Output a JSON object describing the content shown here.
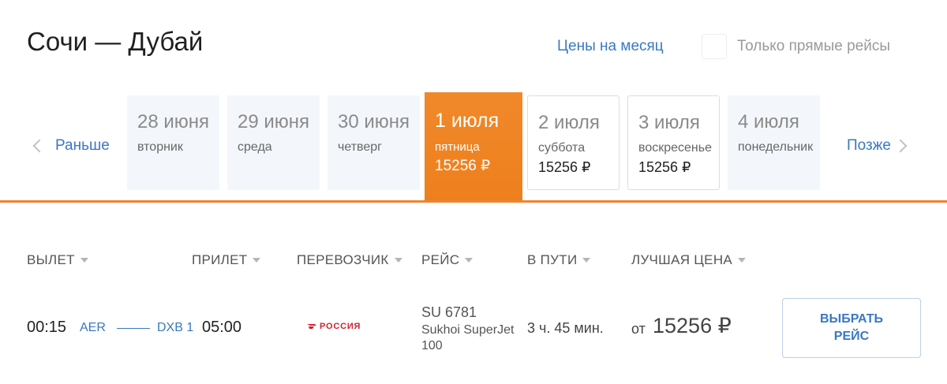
{
  "header": {
    "title": "Сочи — Дубай",
    "month_prices_link": "Цены на месяц",
    "direct_only_label": "Только прямые рейсы"
  },
  "date_nav": {
    "prev_label": "Раньше",
    "next_label": "Позже",
    "days": [
      {
        "date": "28 июня",
        "weekday": "вторник",
        "price": ""
      },
      {
        "date": "29 июня",
        "weekday": "среда",
        "price": ""
      },
      {
        "date": "30 июня",
        "weekday": "четверг",
        "price": ""
      },
      {
        "date": "1 июля",
        "weekday": "пятница",
        "price": "15256 ₽"
      },
      {
        "date": "2 июля",
        "weekday": "суббота",
        "price": "15256 ₽"
      },
      {
        "date": "3 июля",
        "weekday": "воскресенье",
        "price": "15256 ₽"
      },
      {
        "date": "4 июля",
        "weekday": "понедельник",
        "price": ""
      }
    ],
    "selected_index": 3
  },
  "table": {
    "columns": [
      "ВЫЛЕТ",
      "ПРИЛЕТ",
      "ПЕРЕВОЗЧИК",
      "РЕЙС",
      "В ПУТИ",
      "ЛУЧШАЯ ЦЕНА"
    ],
    "rows": [
      {
        "departure_time": "00:15",
        "departure_airport": "AER",
        "arrival_airport": "DXB 1",
        "arrival_time": "05:00",
        "airline": "РОССИЯ",
        "flight_number": "SU 6781",
        "aircraft": "Sukhoi SuperJet 100",
        "duration": "3 ч. 45 мин.",
        "price_prefix": "от",
        "price": "15256 ₽",
        "select_label": "ВЫБРАТЬ РЕЙС"
      }
    ]
  },
  "colors": {
    "accent": "#ee7f1d",
    "link": "#3a78c2",
    "airline_red": "#d12030",
    "day_bg": "#f3f7fc"
  },
  "icons": {
    "prev": "chevron-left-icon",
    "next": "chevron-right-icon",
    "sort": "caret-down-icon",
    "airline": "rossiya-logo"
  }
}
